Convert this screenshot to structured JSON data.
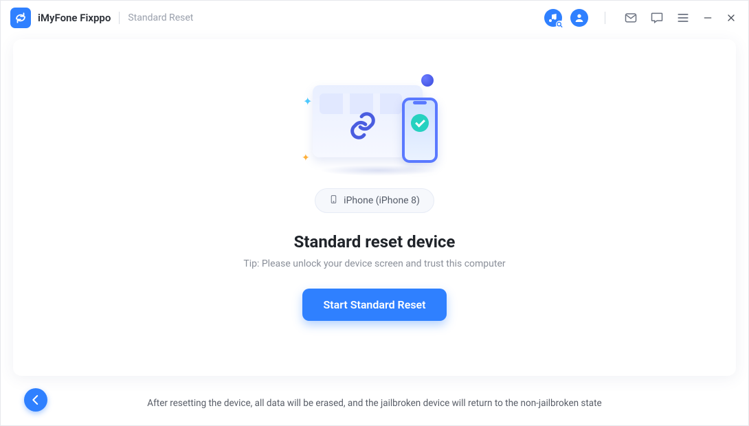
{
  "header": {
    "app_name": "iMyFone Fixppo",
    "mode": "Standard Reset"
  },
  "main": {
    "device_label": "iPhone (iPhone 8)",
    "heading": "Standard reset device",
    "tip": "Tip: Please unlock your device screen and trust this computer",
    "cta": "Start Standard Reset"
  },
  "footer": {
    "note": "After resetting the device, all data will be erased, and the jailbroken device will return to the non-jailbroken state"
  }
}
